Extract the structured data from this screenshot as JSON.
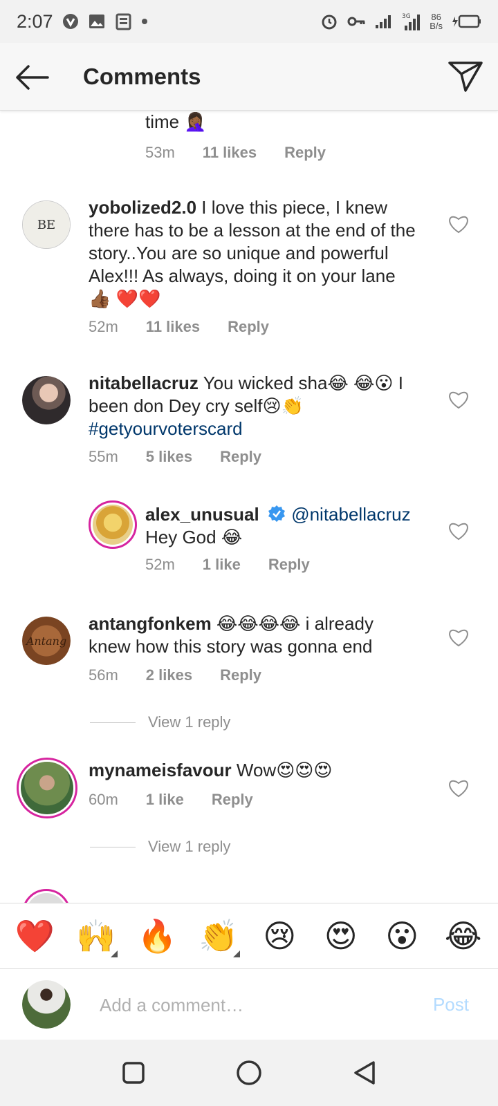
{
  "status_bar": {
    "time": "2:07",
    "net_speed_value": "86",
    "net_speed_unit": "B/s",
    "icons": [
      "vpn-icon",
      "image-icon",
      "news-icon",
      "dot-icon",
      "alarm-icon",
      "key-icon",
      "signal-icon",
      "signal-icon",
      "battery-icon"
    ]
  },
  "header": {
    "title": "Comments"
  },
  "comments": [
    {
      "text": "time 🤦🏾‍♀️",
      "time": "53m",
      "likes": "11 likes",
      "reply": "Reply"
    },
    {
      "username": "yobolized2.0",
      "text": "I love this piece, I knew there has to be a lesson at the end of the story..You are so unique and powerful Alex!!! As always, doing it on your lane 👍🏾 ❤️❤️",
      "time": "52m",
      "likes": "11 likes",
      "reply": "Reply"
    },
    {
      "username": "nitabellacruz",
      "text": "You wicked sha😂 😂😮 I been don Dey cry self😢👏",
      "hashtag": "#getyourvoterscard",
      "time": "55m",
      "likes": "5 likes",
      "reply": "Reply"
    },
    {
      "username": "alex_unusual",
      "mention": "@nitabellacruz",
      "text": "Hey God 😂",
      "time": "52m",
      "likes": "1 like",
      "reply": "Reply"
    },
    {
      "username": "antangfonkem",
      "text": "😂😂😂😂 i already knew how this story was gonna end",
      "time": "56m",
      "likes": "2 likes",
      "reply": "Reply",
      "view_replies": "View 1 reply"
    },
    {
      "username": "mynameisfavour",
      "text": "Wow😍😍😍",
      "time": "60m",
      "likes": "1 like",
      "reply": "Reply",
      "view_replies": "View 1 reply"
    }
  ],
  "emoji_bar": [
    "❤️",
    "🙌",
    "🔥",
    "👏",
    "😢",
    "😍",
    "😮",
    "😂"
  ],
  "composer": {
    "placeholder": "Add a comment…",
    "post": "Post"
  },
  "colors": {
    "link": "#00376b",
    "meta": "#8e8e8e",
    "post_disabled": "#b3dbff",
    "story_ring": "#d6249f",
    "verified": "#3897f0"
  }
}
